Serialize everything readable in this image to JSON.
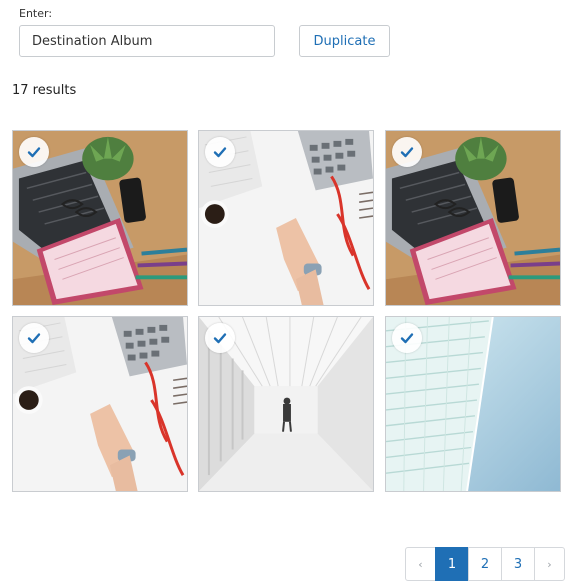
{
  "form": {
    "enter_label": "Enter:",
    "album_value": "Destination Album",
    "duplicate_label": "Duplicate"
  },
  "results": {
    "count_text": "17 results"
  },
  "images": [
    {
      "content": "desk-laptop-notebook",
      "selected": true
    },
    {
      "content": "desk-calculator-hand",
      "selected": true
    },
    {
      "content": "desk-laptop-notebook",
      "selected": true
    },
    {
      "content": "desk-calculator-hand",
      "selected": true
    },
    {
      "content": "white-corridor",
      "selected": true
    },
    {
      "content": "glass-building",
      "selected": true
    }
  ],
  "pagination": {
    "prev": "‹",
    "pages": [
      "1",
      "2",
      "3"
    ],
    "active_page": "1",
    "next": "›"
  },
  "colors": {
    "accent": "#1f6fb5",
    "check": "#1f6fb5"
  },
  "icons": {
    "selected": "check-icon",
    "prev": "chevron-left-icon",
    "next": "chevron-right-icon"
  }
}
